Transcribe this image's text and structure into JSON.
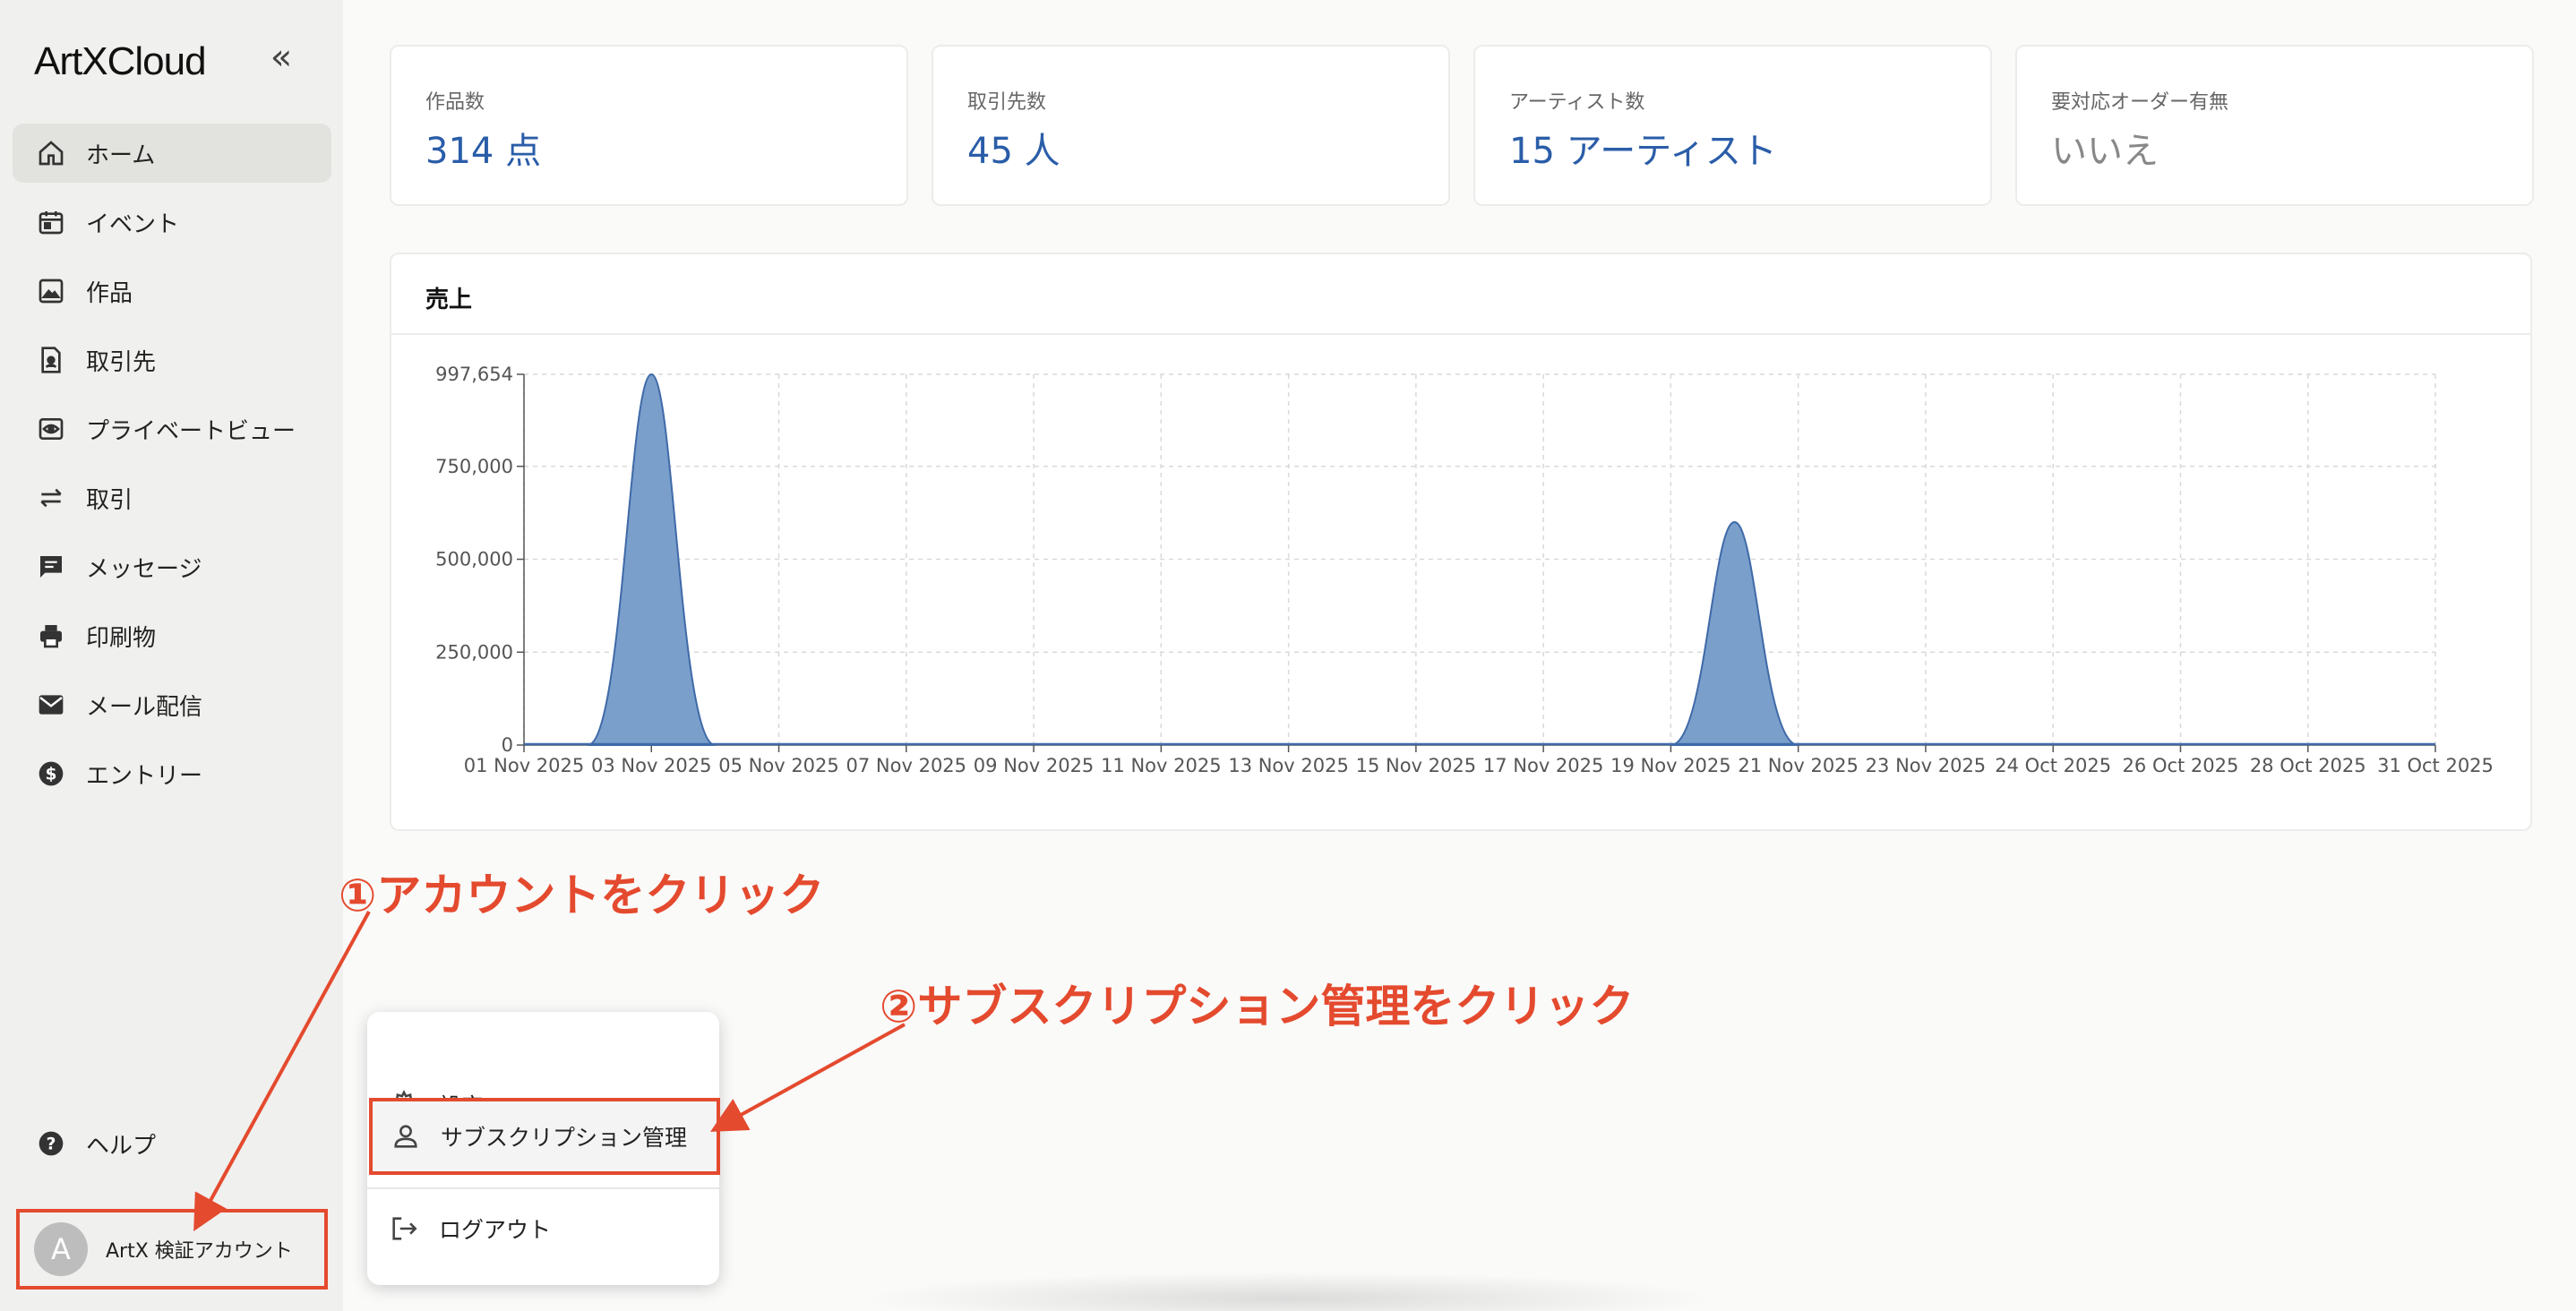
{
  "app": {
    "logo": "ArtXCloud",
    "collapse_icon": "double-chevron-left-icon"
  },
  "sidebar": {
    "items": [
      {
        "label": "ホーム",
        "icon": "home-icon",
        "active": true
      },
      {
        "label": "イベント",
        "icon": "calendar-icon"
      },
      {
        "label": "作品",
        "icon": "image-icon"
      },
      {
        "label": "取引先",
        "icon": "contact-icon"
      },
      {
        "label": "プライベートビュー",
        "icon": "eye-icon"
      },
      {
        "label": "取引",
        "icon": "swap-icon"
      },
      {
        "label": "メッセージ",
        "icon": "message-icon"
      },
      {
        "label": "印刷物",
        "icon": "printer-icon"
      },
      {
        "label": "メール配信",
        "icon": "mail-icon"
      },
      {
        "label": "エントリー",
        "icon": "dollar-icon"
      }
    ],
    "help_label": "ヘルプ",
    "account": {
      "avatar_letter": "A",
      "name": "ArtX 検証アカウント"
    }
  },
  "stats": [
    {
      "label": "作品数",
      "value": "314 点"
    },
    {
      "label": "取引先数",
      "value": "45 人"
    },
    {
      "label": "アーティスト数",
      "value": "15 アーティスト"
    },
    {
      "label": "要対応オーダー有無",
      "value": "いいえ"
    }
  ],
  "sales": {
    "title": "売上"
  },
  "chart_data": {
    "type": "area",
    "title": "売上",
    "categories": [
      "01 Nov 2025",
      "03 Nov 2025",
      "05 Nov 2025",
      "07 Nov 2025",
      "09 Nov 2025",
      "11 Nov 2025",
      "13 Nov 2025",
      "15 Nov 2025",
      "17 Nov 2025",
      "19 Nov 2025",
      "21 Nov 2025",
      "23 Nov 2025",
      "24 Oct 2025",
      "26 Oct 2025",
      "28 Oct 2025",
      "31 Oct 2025"
    ],
    "peaks": [
      {
        "x": "03 Nov 2025",
        "value": 997654
      },
      {
        "x": "20 Nov 2025",
        "value": 600000
      }
    ],
    "yticks": [
      "0",
      "250,000",
      "500,000",
      "750,000",
      "997,654"
    ],
    "ylim": [
      0,
      997654
    ],
    "grid": true,
    "color": "#7b9fcb",
    "line_color": "#3f6aa8"
  },
  "menu": {
    "items": [
      {
        "label": "設定",
        "icon": "gear-icon"
      },
      {
        "label": "サブスクリプション管理",
        "icon": "user-icon"
      },
      {
        "label": "ログアウト",
        "icon": "logout-icon"
      }
    ]
  },
  "annotations": {
    "step1": "①アカウントをクリック",
    "step2": "②サブスクリプション管理をクリック",
    "color": "#e44a2e"
  }
}
